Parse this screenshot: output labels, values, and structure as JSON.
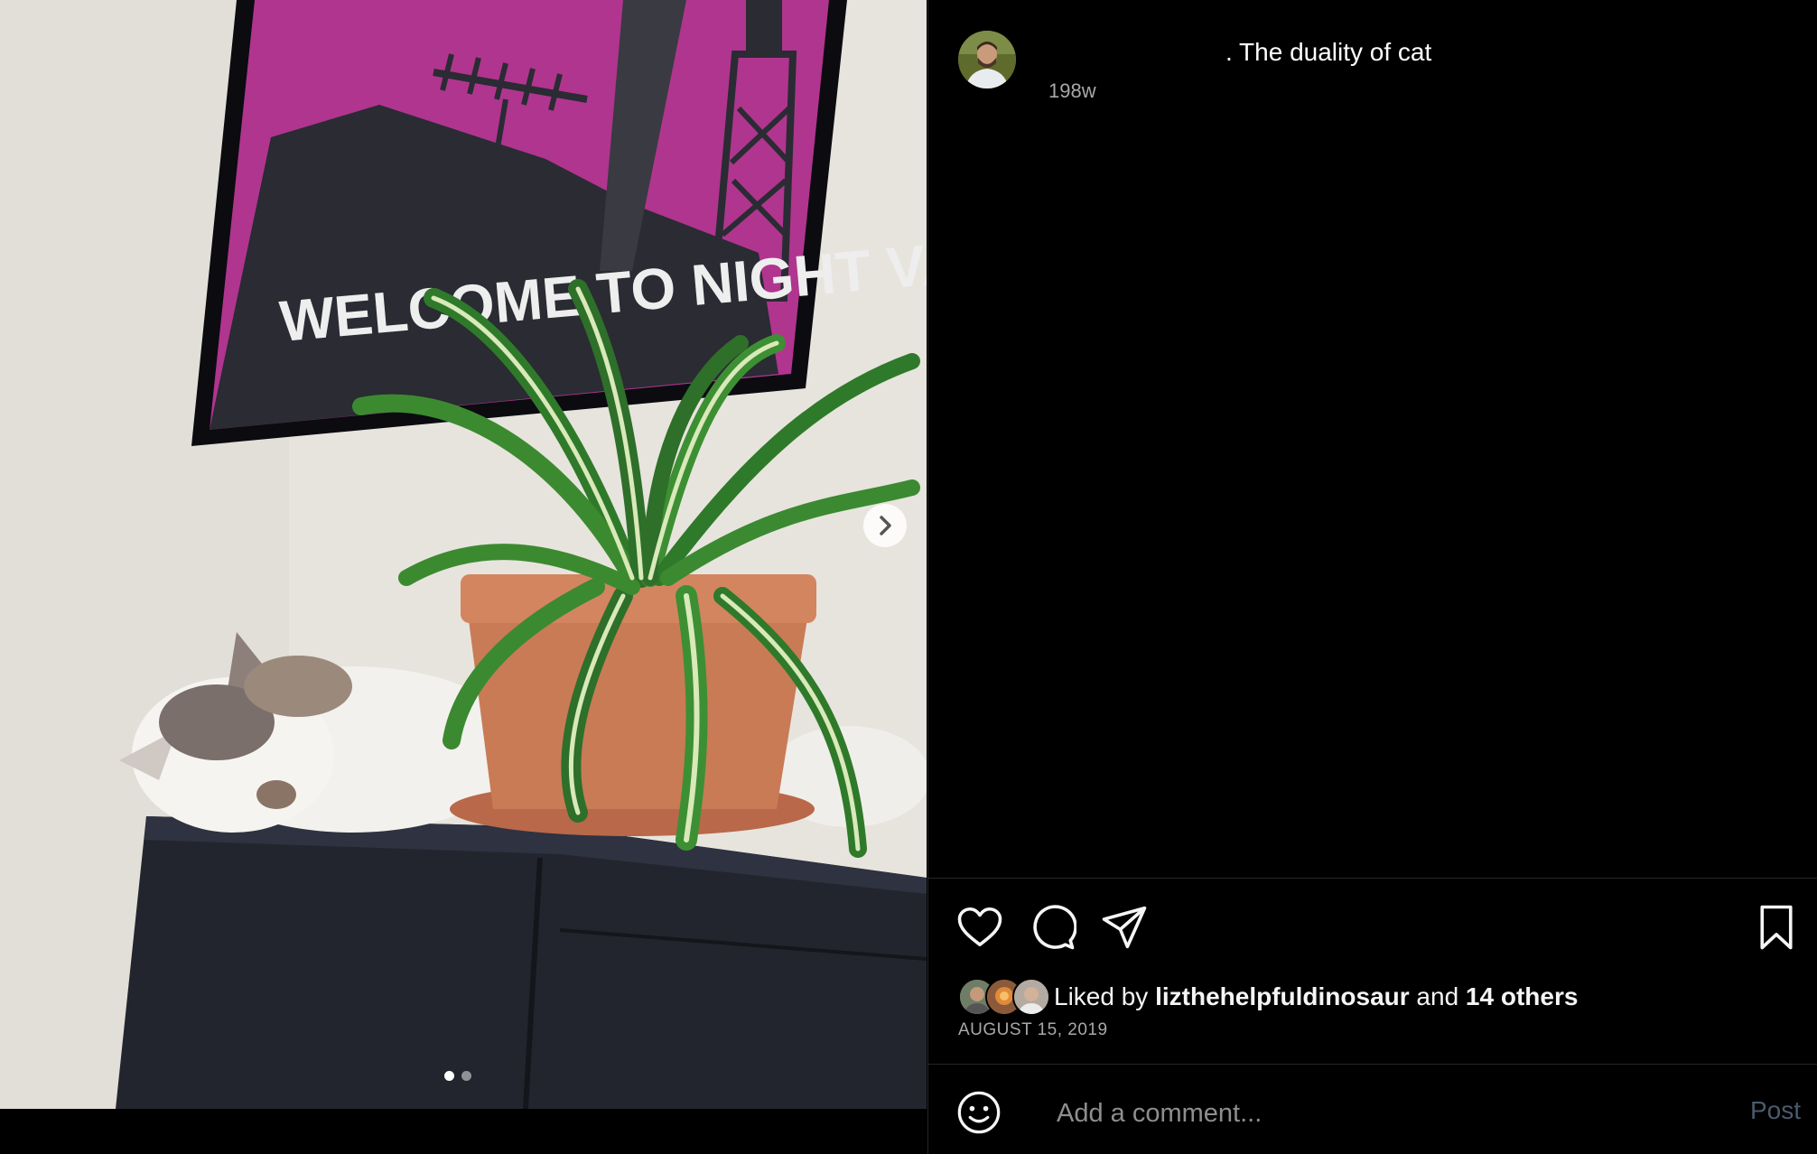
{
  "post": {
    "caption": ". The duality of cat",
    "age": "198w",
    "date": "AUGUST 15, 2019"
  },
  "media": {
    "poster_text": "WELCOME TO NIGHT VALE",
    "slide_count": 2,
    "current_slide": 1
  },
  "likes": {
    "prefix": "Liked by",
    "user": "lizthehelpfuldinosaur",
    "connector": "and",
    "others": "14 others"
  },
  "comment": {
    "placeholder": "Add a comment...",
    "post_label": "Post"
  },
  "colors": {
    "background": "#000000",
    "text": "#f5f5f5",
    "muted": "#a8a8a8",
    "post_button_disabled": "#4b5a6e"
  },
  "icons": [
    "heart-icon",
    "comment-icon",
    "share-icon",
    "bookmark-icon",
    "emoji-icon",
    "chevron-right-icon"
  ]
}
